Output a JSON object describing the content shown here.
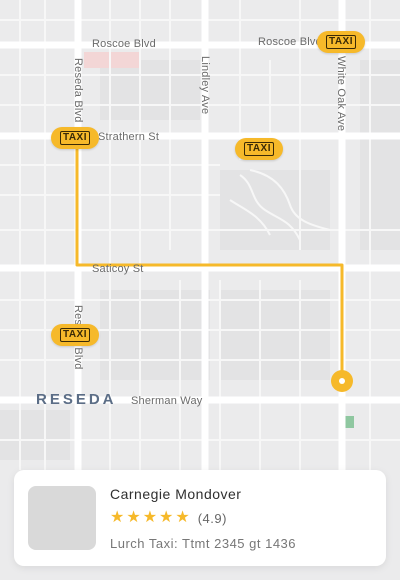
{
  "map": {
    "streets": {
      "roscoe_left": "Roscoe Blvd",
      "roscoe_right": "Roscoe Blvd",
      "reseda_top": "Reseda Blvd",
      "reseda_bottom": "Reseda Blvd",
      "lindley": "Lindley Ave",
      "white_oak": "White Oak Ave",
      "strathern": "Strathern St",
      "saticoy": "Saticoy St",
      "sherman": "Sherman Way"
    },
    "area_label": "RESEDA",
    "taxi_label": "TAXI",
    "route_color": "#f6b92a",
    "taxis": [
      "taxi-top-right",
      "taxi-left-start",
      "taxi-center",
      "taxi-left-lower"
    ]
  },
  "driver_card": {
    "name": "Carnegie Mondover",
    "stars": [
      "★",
      "★",
      "★",
      "★",
      "★"
    ],
    "rating": "(4.9)",
    "info": "Lurch Taxi: Ttmt 2345 gt 1436"
  },
  "colors": {
    "accent": "#f6b92a",
    "map_background": "#ebebec",
    "road": "#ffffff",
    "area_label": "#5b6d86"
  }
}
